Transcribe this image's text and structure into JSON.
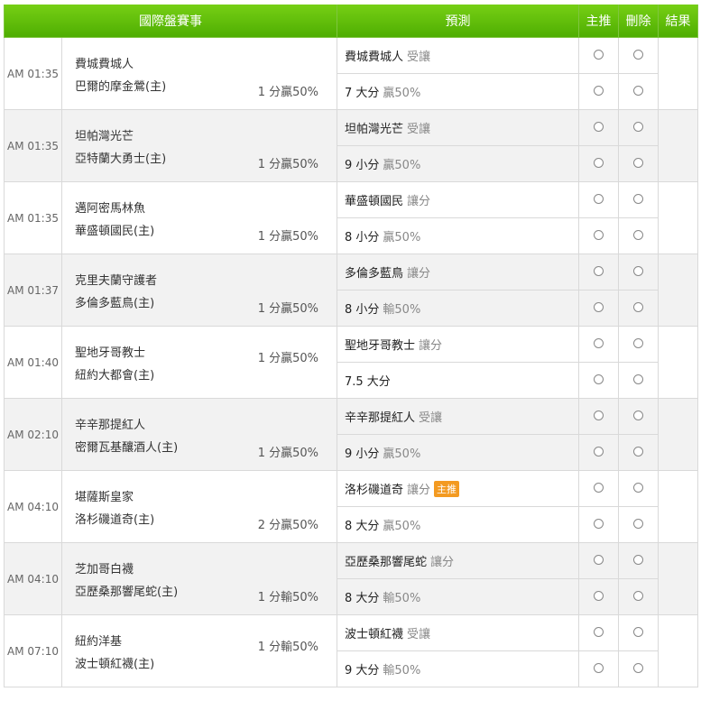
{
  "header": {
    "match_col": "國際盤賽事",
    "prediction_col": "預測",
    "main_col": "主推",
    "delete_col": "刪除",
    "result_col": "結果"
  },
  "games": [
    {
      "time": "AM 01:35",
      "team1": "費城費城人",
      "team2": "巴爾的摩金鶯(主)",
      "handicap": "1 分贏50%",
      "handicap_pos": "down",
      "pred1_main": "費城費城人",
      "pred1_note": "受讓",
      "pred1_badge": "",
      "pred2_main": "7 大分",
      "pred2_note": "贏50%"
    },
    {
      "time": "AM 01:35",
      "team1": "坦帕灣光芒",
      "team2": "亞特蘭大勇士(主)",
      "handicap": "1 分贏50%",
      "handicap_pos": "down",
      "pred1_main": "坦帕灣光芒",
      "pred1_note": "受讓",
      "pred1_badge": "",
      "pred2_main": "9 小分",
      "pred2_note": "贏50%"
    },
    {
      "time": "AM 01:35",
      "team1": "邁阿密馬林魚",
      "team2": "華盛頓國民(主)",
      "handicap": "1 分贏50%",
      "handicap_pos": "down",
      "pred1_main": "華盛頓國民",
      "pred1_note": "讓分",
      "pred1_badge": "",
      "pred2_main": "8 小分",
      "pred2_note": "贏50%"
    },
    {
      "time": "AM 01:37",
      "team1": "克里夫蘭守護者",
      "team2": "多倫多藍鳥(主)",
      "handicap": "1 分贏50%",
      "handicap_pos": "down",
      "pred1_main": "多倫多藍鳥",
      "pred1_note": "讓分",
      "pred1_badge": "",
      "pred2_main": "8 小分",
      "pred2_note": "輸50%"
    },
    {
      "time": "AM 01:40",
      "team1": "聖地牙哥教士",
      "team2": "紐約大都會(主)",
      "handicap": "1 分贏50%",
      "handicap_pos": "up",
      "pred1_main": "聖地牙哥教士",
      "pred1_note": "讓分",
      "pred1_badge": "",
      "pred2_main": "7.5 大分",
      "pred2_note": ""
    },
    {
      "time": "AM 02:10",
      "team1": "辛辛那提紅人",
      "team2": "密爾瓦基釀酒人(主)",
      "handicap": "1 分贏50%",
      "handicap_pos": "down",
      "pred1_main": "辛辛那提紅人",
      "pred1_note": "受讓",
      "pred1_badge": "",
      "pred2_main": "9 小分",
      "pred2_note": "贏50%"
    },
    {
      "time": "AM 04:10",
      "team1": "堪薩斯皇家",
      "team2": "洛杉磯道奇(主)",
      "handicap": "2 分贏50%",
      "handicap_pos": "down",
      "pred1_main": "洛杉磯道奇",
      "pred1_note": "讓分",
      "pred1_badge": "主推",
      "pred2_main": "8 大分",
      "pred2_note": "贏50%"
    },
    {
      "time": "AM 04:10",
      "team1": "芝加哥白襪",
      "team2": "亞歷桑那響尾蛇(主)",
      "handicap": "1 分輸50%",
      "handicap_pos": "down",
      "pred1_main": "亞歷桑那響尾蛇",
      "pred1_note": "讓分",
      "pred1_badge": "",
      "pred2_main": "8 大分",
      "pred2_note": "輸50%"
    },
    {
      "time": "AM 07:10",
      "team1": "紐約洋基",
      "team2": "波士頓紅襪(主)",
      "handicap": "1 分輸50%",
      "handicap_pos": "up",
      "pred1_main": "波士頓紅襪",
      "pred1_note": "受讓",
      "pred1_badge": "",
      "pred2_main": "9 大分",
      "pred2_note": "輸50%"
    }
  ]
}
